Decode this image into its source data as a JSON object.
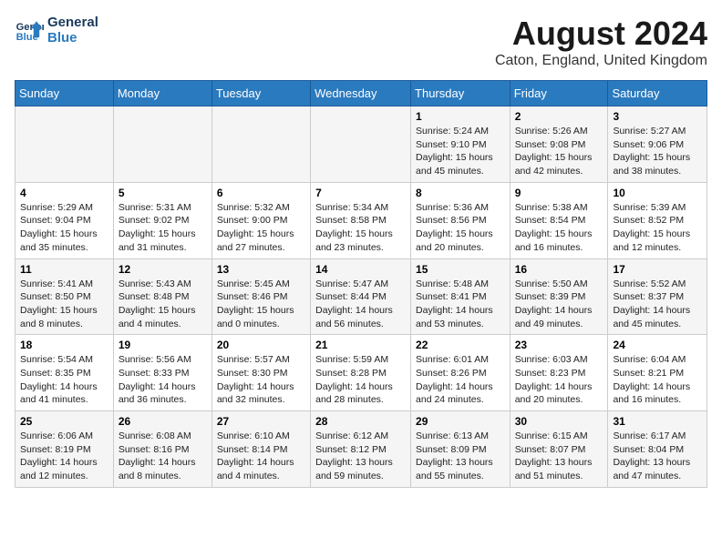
{
  "header": {
    "logo_line1": "General",
    "logo_line2": "Blue",
    "main_title": "August 2024",
    "subtitle": "Caton, England, United Kingdom"
  },
  "days_of_week": [
    "Sunday",
    "Monday",
    "Tuesday",
    "Wednesday",
    "Thursday",
    "Friday",
    "Saturday"
  ],
  "weeks": [
    [
      {
        "day": "",
        "info": ""
      },
      {
        "day": "",
        "info": ""
      },
      {
        "day": "",
        "info": ""
      },
      {
        "day": "",
        "info": ""
      },
      {
        "day": "1",
        "info": "Sunrise: 5:24 AM\nSunset: 9:10 PM\nDaylight: 15 hours\nand 45 minutes."
      },
      {
        "day": "2",
        "info": "Sunrise: 5:26 AM\nSunset: 9:08 PM\nDaylight: 15 hours\nand 42 minutes."
      },
      {
        "day": "3",
        "info": "Sunrise: 5:27 AM\nSunset: 9:06 PM\nDaylight: 15 hours\nand 38 minutes."
      }
    ],
    [
      {
        "day": "4",
        "info": "Sunrise: 5:29 AM\nSunset: 9:04 PM\nDaylight: 15 hours\nand 35 minutes."
      },
      {
        "day": "5",
        "info": "Sunrise: 5:31 AM\nSunset: 9:02 PM\nDaylight: 15 hours\nand 31 minutes."
      },
      {
        "day": "6",
        "info": "Sunrise: 5:32 AM\nSunset: 9:00 PM\nDaylight: 15 hours\nand 27 minutes."
      },
      {
        "day": "7",
        "info": "Sunrise: 5:34 AM\nSunset: 8:58 PM\nDaylight: 15 hours\nand 23 minutes."
      },
      {
        "day": "8",
        "info": "Sunrise: 5:36 AM\nSunset: 8:56 PM\nDaylight: 15 hours\nand 20 minutes."
      },
      {
        "day": "9",
        "info": "Sunrise: 5:38 AM\nSunset: 8:54 PM\nDaylight: 15 hours\nand 16 minutes."
      },
      {
        "day": "10",
        "info": "Sunrise: 5:39 AM\nSunset: 8:52 PM\nDaylight: 15 hours\nand 12 minutes."
      }
    ],
    [
      {
        "day": "11",
        "info": "Sunrise: 5:41 AM\nSunset: 8:50 PM\nDaylight: 15 hours\nand 8 minutes."
      },
      {
        "day": "12",
        "info": "Sunrise: 5:43 AM\nSunset: 8:48 PM\nDaylight: 15 hours\nand 4 minutes."
      },
      {
        "day": "13",
        "info": "Sunrise: 5:45 AM\nSunset: 8:46 PM\nDaylight: 15 hours\nand 0 minutes."
      },
      {
        "day": "14",
        "info": "Sunrise: 5:47 AM\nSunset: 8:44 PM\nDaylight: 14 hours\nand 56 minutes."
      },
      {
        "day": "15",
        "info": "Sunrise: 5:48 AM\nSunset: 8:41 PM\nDaylight: 14 hours\nand 53 minutes."
      },
      {
        "day": "16",
        "info": "Sunrise: 5:50 AM\nSunset: 8:39 PM\nDaylight: 14 hours\nand 49 minutes."
      },
      {
        "day": "17",
        "info": "Sunrise: 5:52 AM\nSunset: 8:37 PM\nDaylight: 14 hours\nand 45 minutes."
      }
    ],
    [
      {
        "day": "18",
        "info": "Sunrise: 5:54 AM\nSunset: 8:35 PM\nDaylight: 14 hours\nand 41 minutes."
      },
      {
        "day": "19",
        "info": "Sunrise: 5:56 AM\nSunset: 8:33 PM\nDaylight: 14 hours\nand 36 minutes."
      },
      {
        "day": "20",
        "info": "Sunrise: 5:57 AM\nSunset: 8:30 PM\nDaylight: 14 hours\nand 32 minutes."
      },
      {
        "day": "21",
        "info": "Sunrise: 5:59 AM\nSunset: 8:28 PM\nDaylight: 14 hours\nand 28 minutes."
      },
      {
        "day": "22",
        "info": "Sunrise: 6:01 AM\nSunset: 8:26 PM\nDaylight: 14 hours\nand 24 minutes."
      },
      {
        "day": "23",
        "info": "Sunrise: 6:03 AM\nSunset: 8:23 PM\nDaylight: 14 hours\nand 20 minutes."
      },
      {
        "day": "24",
        "info": "Sunrise: 6:04 AM\nSunset: 8:21 PM\nDaylight: 14 hours\nand 16 minutes."
      }
    ],
    [
      {
        "day": "25",
        "info": "Sunrise: 6:06 AM\nSunset: 8:19 PM\nDaylight: 14 hours\nand 12 minutes."
      },
      {
        "day": "26",
        "info": "Sunrise: 6:08 AM\nSunset: 8:16 PM\nDaylight: 14 hours\nand 8 minutes."
      },
      {
        "day": "27",
        "info": "Sunrise: 6:10 AM\nSunset: 8:14 PM\nDaylight: 14 hours\nand 4 minutes."
      },
      {
        "day": "28",
        "info": "Sunrise: 6:12 AM\nSunset: 8:12 PM\nDaylight: 13 hours\nand 59 minutes."
      },
      {
        "day": "29",
        "info": "Sunrise: 6:13 AM\nSunset: 8:09 PM\nDaylight: 13 hours\nand 55 minutes."
      },
      {
        "day": "30",
        "info": "Sunrise: 6:15 AM\nSunset: 8:07 PM\nDaylight: 13 hours\nand 51 minutes."
      },
      {
        "day": "31",
        "info": "Sunrise: 6:17 AM\nSunset: 8:04 PM\nDaylight: 13 hours\nand 47 minutes."
      }
    ]
  ]
}
